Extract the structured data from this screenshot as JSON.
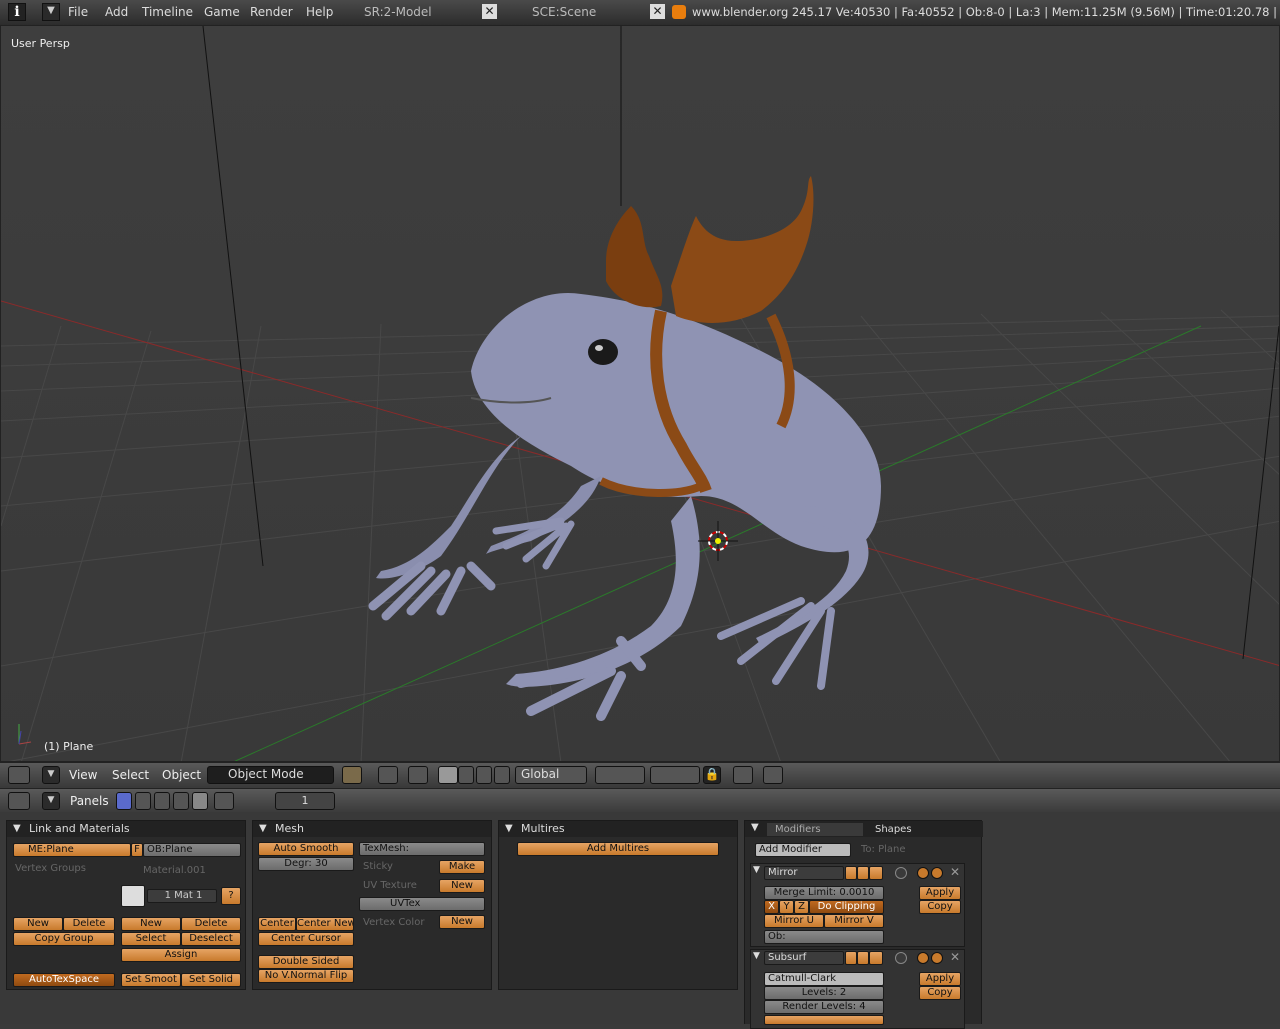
{
  "topbar": {
    "menus": [
      "File",
      "Add",
      "Timeline",
      "Game",
      "Render",
      "Help"
    ],
    "screen": "SR:2-Model",
    "scene": "SCE:Scene",
    "stats": "www.blender.org 245.17   Ve:40530 | Fa:40552 | Ob:8-0 | La:3   | Mem:11.25M (9.56M)   | Time:01:20.78 |"
  },
  "viewport": {
    "view_name": "User Persp",
    "object_label": "(1) Plane"
  },
  "view_header": {
    "menus": [
      "View",
      "Select",
      "Object"
    ],
    "mode": "Object Mode",
    "orientation": "Global"
  },
  "buttons_header": {
    "panels_label": "Panels",
    "frame": "1"
  },
  "link_materials": {
    "title": "Link and Materials",
    "mesh": "ME:Plane",
    "f": "F",
    "object": "OB:Plane",
    "vertex_groups": "Vertex Groups",
    "material": "Material.001",
    "mat_index": "1 Mat 1",
    "question": "?",
    "new": "New",
    "delete": "Delete",
    "copy_group": "Copy Group",
    "mat_new": "New",
    "mat_delete": "Delete",
    "select": "Select",
    "deselect": "Deselect",
    "assign": "Assign",
    "autotexspace": "AutoTexSpace",
    "set_smooth": "Set Smoot",
    "set_solid": "Set Solid"
  },
  "mesh": {
    "title": "Mesh",
    "auto_smooth": "Auto Smooth",
    "degr": "Degr: 30",
    "texmesh": "TexMesh:",
    "sticky": "Sticky",
    "make": "Make",
    "uv_texture": "UV Texture",
    "uv_new": "New",
    "uvtex": "UVTex",
    "vertex_color": "Vertex Color",
    "vc_new": "New",
    "center": "Center",
    "center_new": "Center New",
    "center_cursor": "Center Cursor",
    "double_sided": "Double Sided",
    "no_vnormal_flip": "No V.Normal Flip"
  },
  "multires": {
    "title": "Multires",
    "add": "Add Multires"
  },
  "modifiers": {
    "tab_modifiers": "Modifiers",
    "tab_shapes": "Shapes",
    "add_modifier": "Add Modifier",
    "to": "To: Plane",
    "mirror": {
      "name": "Mirror",
      "merge_limit": "Merge Limit: 0.0010",
      "x": "X",
      "y": "Y",
      "z": "Z",
      "do_clipping": "Do Clipping",
      "mirror_u": "Mirror U",
      "mirror_v": "Mirror V",
      "ob": "Ob:",
      "apply": "Apply",
      "copy": "Copy"
    },
    "subsurf": {
      "name": "Subsurf",
      "type": "Catmull-Clark",
      "levels": "Levels: 2",
      "render_levels": "Render Levels: 4",
      "apply": "Apply",
      "copy": "Copy"
    }
  }
}
